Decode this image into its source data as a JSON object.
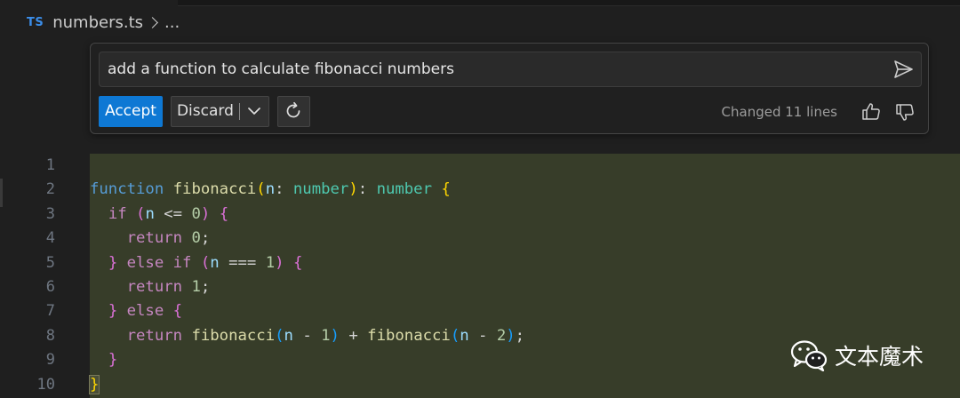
{
  "breadcrumb": {
    "file_badge": "TS",
    "file_name": "numbers.ts",
    "ellipsis": "..."
  },
  "inline_chat": {
    "prompt_value": "add a function to calculate fibonacci numbers",
    "accept_label": "Accept",
    "discard_label": "Discard",
    "status_text": "Changed 11 lines",
    "icons": {
      "send": "send-icon",
      "dropdown": "chevron-down-icon",
      "rerun": "refresh-icon",
      "thumbs_up": "thumbs-up-icon",
      "thumbs_down": "thumbs-down-icon"
    },
    "accent_color": "#0e78d4"
  },
  "editor": {
    "line_numbers": [
      "1",
      "2",
      "3",
      "4",
      "5",
      "6",
      "7",
      "8",
      "9",
      "10"
    ],
    "diff_color": "#373d29",
    "code_lines": [
      [],
      [
        {
          "t": "function",
          "c": "kw-blue"
        },
        {
          "t": " ",
          "c": "op"
        },
        {
          "t": "fibonacci",
          "c": "fn"
        },
        {
          "t": "(",
          "c": "br-gold"
        },
        {
          "t": "n",
          "c": "param"
        },
        {
          "t": ": ",
          "c": "op"
        },
        {
          "t": "number",
          "c": "type"
        },
        {
          "t": ")",
          "c": "br-gold"
        },
        {
          "t": ": ",
          "c": "op"
        },
        {
          "t": "number",
          "c": "type"
        },
        {
          "t": " ",
          "c": "op"
        },
        {
          "t": "{",
          "c": "br-gold"
        }
      ],
      [
        {
          "t": "  ",
          "c": "op"
        },
        {
          "t": "if",
          "c": "kw-purple"
        },
        {
          "t": " ",
          "c": "op"
        },
        {
          "t": "(",
          "c": "br-pink"
        },
        {
          "t": "n",
          "c": "param"
        },
        {
          "t": " <= ",
          "c": "op"
        },
        {
          "t": "0",
          "c": "num"
        },
        {
          "t": ")",
          "c": "br-pink"
        },
        {
          "t": " ",
          "c": "op"
        },
        {
          "t": "{",
          "c": "br-pink"
        }
      ],
      [
        {
          "t": "    ",
          "c": "op"
        },
        {
          "t": "return",
          "c": "kw-purple"
        },
        {
          "t": " ",
          "c": "op"
        },
        {
          "t": "0",
          "c": "num"
        },
        {
          "t": ";",
          "c": "op"
        }
      ],
      [
        {
          "t": "  ",
          "c": "op"
        },
        {
          "t": "}",
          "c": "br-pink"
        },
        {
          "t": " ",
          "c": "op"
        },
        {
          "t": "else",
          "c": "kw-purple"
        },
        {
          "t": " ",
          "c": "op"
        },
        {
          "t": "if",
          "c": "kw-purple"
        },
        {
          "t": " ",
          "c": "op"
        },
        {
          "t": "(",
          "c": "br-pink"
        },
        {
          "t": "n",
          "c": "param"
        },
        {
          "t": " === ",
          "c": "op"
        },
        {
          "t": "1",
          "c": "num"
        },
        {
          "t": ")",
          "c": "br-pink"
        },
        {
          "t": " ",
          "c": "op"
        },
        {
          "t": "{",
          "c": "br-pink"
        }
      ],
      [
        {
          "t": "    ",
          "c": "op"
        },
        {
          "t": "return",
          "c": "kw-purple"
        },
        {
          "t": " ",
          "c": "op"
        },
        {
          "t": "1",
          "c": "num"
        },
        {
          "t": ";",
          "c": "op"
        }
      ],
      [
        {
          "t": "  ",
          "c": "op"
        },
        {
          "t": "}",
          "c": "br-pink"
        },
        {
          "t": " ",
          "c": "op"
        },
        {
          "t": "else",
          "c": "kw-purple"
        },
        {
          "t": " ",
          "c": "op"
        },
        {
          "t": "{",
          "c": "br-pink"
        }
      ],
      [
        {
          "t": "    ",
          "c": "op"
        },
        {
          "t": "return",
          "c": "kw-purple"
        },
        {
          "t": " ",
          "c": "op"
        },
        {
          "t": "fibonacci",
          "c": "fn"
        },
        {
          "t": "(",
          "c": "br-blue"
        },
        {
          "t": "n",
          "c": "param"
        },
        {
          "t": " - ",
          "c": "op"
        },
        {
          "t": "1",
          "c": "num"
        },
        {
          "t": ")",
          "c": "br-blue"
        },
        {
          "t": " + ",
          "c": "op"
        },
        {
          "t": "fibonacci",
          "c": "fn"
        },
        {
          "t": "(",
          "c": "br-blue"
        },
        {
          "t": "n",
          "c": "param"
        },
        {
          "t": " - ",
          "c": "op"
        },
        {
          "t": "2",
          "c": "num"
        },
        {
          "t": ")",
          "c": "br-blue"
        },
        {
          "t": ";",
          "c": "op"
        }
      ],
      [
        {
          "t": "  ",
          "c": "op"
        },
        {
          "t": "}",
          "c": "br-pink"
        }
      ],
      [
        {
          "t": "}",
          "c": "br-gold cursor-brace"
        }
      ]
    ]
  },
  "watermark": {
    "logo_icon": "wechat-logo-icon",
    "text": "文本魔术"
  }
}
